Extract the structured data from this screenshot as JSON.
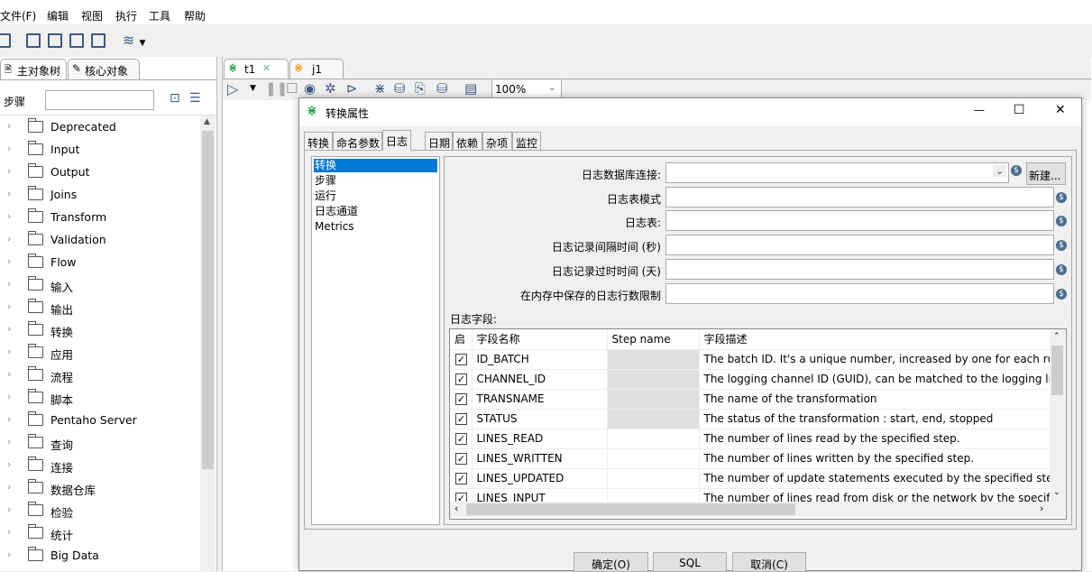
{
  "menu": [
    "文件(F)",
    "编辑",
    "视图",
    "执行",
    "工具",
    "帮助"
  ],
  "left_panel": {
    "tabs": [
      "主对象树",
      "核心对象"
    ],
    "search_label": "步骤",
    "search_value": "",
    "tree": [
      "Deprecated",
      "Input",
      "Output",
      "Joins",
      "Transform",
      "Validation",
      "Flow",
      "输入",
      "输出",
      "转换",
      "应用",
      "流程",
      "脚本",
      "Pentaho Server",
      "查询",
      "连接",
      "数据仓库",
      "检验",
      "统计",
      "Big Data"
    ]
  },
  "editor": {
    "tabs": [
      "t1",
      "j1"
    ],
    "zoom": "100%"
  },
  "dialog": {
    "title": "转换属性",
    "tabs": [
      "转换",
      "命名参数",
      "日志",
      "日期",
      "依赖",
      "杂项",
      "监控"
    ],
    "active_tab": "日志",
    "log_types": [
      "转换",
      "步骤",
      "运行",
      "日志通道",
      "Metrics"
    ],
    "selected_log_type": "转换",
    "fields": [
      {
        "label": "日志数据库连接:",
        "value": ""
      },
      {
        "label": "日志表模式",
        "value": ""
      },
      {
        "label": "日志表:",
        "value": ""
      },
      {
        "label": "日志记录间隔时间 (秒)",
        "value": ""
      },
      {
        "label": "日志记录过时时间 (天)",
        "value": ""
      },
      {
        "label": "在内存中保存的日志行数限制",
        "value": ""
      }
    ],
    "new_button": "新建...",
    "log_fields_label": "日志字段:",
    "table": {
      "headers": [
        "启",
        "字段名称",
        "Step name",
        "字段描述"
      ],
      "rows": [
        {
          "enabled": true,
          "name": "ID_BATCH",
          "step": "",
          "desc": "The batch ID. It's a unique number, increased by one for each run"
        },
        {
          "enabled": true,
          "name": "CHANNEL_ID",
          "step": "",
          "desc": "The logging channel ID (GUID), can be matched to the logging lineage"
        },
        {
          "enabled": true,
          "name": "TRANSNAME",
          "step": "",
          "desc": "The name of the transformation"
        },
        {
          "enabled": true,
          "name": "STATUS",
          "step": "",
          "desc": "The status of the transformation : start, end, stopped"
        },
        {
          "enabled": true,
          "name": "LINES_READ",
          "step": "",
          "desc": "The number of lines read by the specified step."
        },
        {
          "enabled": true,
          "name": "LINES_WRITTEN",
          "step": "",
          "desc": "The number of lines written by the specified step."
        },
        {
          "enabled": true,
          "name": "LINES_UPDATED",
          "step": "",
          "desc": "The number of update statements executed by the specified step."
        },
        {
          "enabled": true,
          "name": "LINES_INPUT",
          "step": "",
          "desc": "The number of lines read from disk or the network by the specified step."
        }
      ]
    },
    "buttons": {
      "ok": "确定(O)",
      "sql": "SQL",
      "cancel": "取消(C)"
    }
  },
  "colors": {
    "selection": "#0078d7",
    "trans_icon": "#2aa147",
    "job_icon": "#f39c12"
  }
}
